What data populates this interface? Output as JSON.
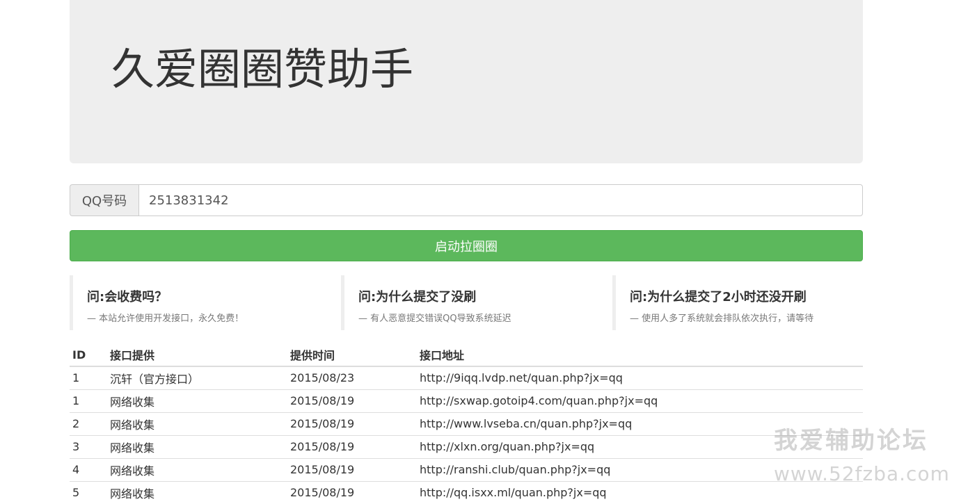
{
  "header": {
    "title": "久爱圈圈赞助手"
  },
  "form": {
    "qq_label": "QQ号码",
    "qq_value": "2513831342",
    "submit_label": "启动拉圈圈"
  },
  "faq": [
    {
      "question": "问:会收费吗？",
      "answer": "— 本站允许使用开发接口，永久免费！"
    },
    {
      "question": "问:为什么提交了没刷",
      "answer": "— 有人恶意提交错误QQ导致系统延迟"
    },
    {
      "question": "问:为什么提交了2小时还没开刷",
      "answer": "— 使用人多了系统就会排队依次执行，请等待"
    }
  ],
  "table": {
    "headers": [
      "ID",
      "接口提供",
      "提供时间",
      "接口地址"
    ],
    "rows": [
      [
        "1",
        "沉轩（官方接口）",
        "2015/08/23",
        "http://9iqq.lvdp.net/quan.php?jx=qq"
      ],
      [
        "1",
        "网络收集",
        "2015/08/19",
        "http://sxwap.gotoip4.com/quan.php?jx=qq"
      ],
      [
        "2",
        "网络收集",
        "2015/08/19",
        "http://www.lvseba.cn/quan.php?jx=qq"
      ],
      [
        "3",
        "网络收集",
        "2015/08/19",
        "http://xlxn.org/quan.php?jx=qq"
      ],
      [
        "4",
        "网络收集",
        "2015/08/19",
        "http://ranshi.club/quan.php?jx=qq"
      ],
      [
        "5",
        "网络收集",
        "2015/08/19",
        "http://qq.isxx.ml/quan.php?jx=qq"
      ]
    ]
  },
  "watermark": {
    "title": "我爱辅助论坛",
    "url": "www.52fzba.com"
  }
}
